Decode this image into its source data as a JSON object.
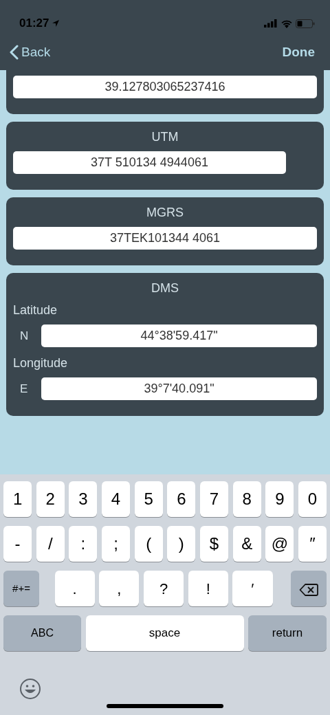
{
  "status_bar": {
    "time": "01:27"
  },
  "nav": {
    "back": "Back",
    "done": "Done"
  },
  "cards": [
    {
      "fields": [
        {
          "value": "39.127803065237416",
          "kind": "wide"
        }
      ]
    },
    {
      "title": "UTM",
      "fields": [
        {
          "value": "37T 510134 4944061",
          "kind": "short"
        }
      ]
    },
    {
      "title": "MGRS",
      "fields": [
        {
          "value": "37TEK101344 4061",
          "kind": "wide"
        }
      ]
    },
    {
      "title": "DMS",
      "fields": [
        {
          "label": "Latitude",
          "prefix": "N",
          "value": "44°38'59.417\"",
          "kind": "wide"
        },
        {
          "label": "Longitude",
          "prefix": "E",
          "value": "39°7'40.091\"",
          "kind": "wide"
        }
      ]
    }
  ],
  "keyboard": {
    "rows": [
      {
        "keys": [
          {
            "label": "1",
            "kind": "char"
          },
          {
            "label": "2",
            "kind": "char"
          },
          {
            "label": "3",
            "kind": "char"
          },
          {
            "label": "4",
            "kind": "char"
          },
          {
            "label": "5",
            "kind": "char"
          },
          {
            "label": "6",
            "kind": "char"
          },
          {
            "label": "7",
            "kind": "char"
          },
          {
            "label": "8",
            "kind": "char"
          },
          {
            "label": "9",
            "kind": "char"
          },
          {
            "label": "0",
            "kind": "char"
          }
        ]
      },
      {
        "keys": [
          {
            "label": "-",
            "kind": "char"
          },
          {
            "label": "/",
            "kind": "char"
          },
          {
            "label": ":",
            "kind": "char"
          },
          {
            "label": ";",
            "kind": "char"
          },
          {
            "label": "(",
            "kind": "char"
          },
          {
            "label": ")",
            "kind": "char"
          },
          {
            "label": "$",
            "kind": "char"
          },
          {
            "label": "&",
            "kind": "char"
          },
          {
            "label": "@",
            "kind": "char"
          },
          {
            "label": "″",
            "kind": "char"
          }
        ]
      },
      {
        "keys": [
          {
            "label": "#+=",
            "kind": "shift"
          },
          {
            "label": ".",
            "kind": "punct"
          },
          {
            "label": ",",
            "kind": "punct"
          },
          {
            "label": "?",
            "kind": "punct"
          },
          {
            "label": "!",
            "kind": "punct"
          },
          {
            "label": "′",
            "kind": "punct"
          },
          {
            "kind": "delete"
          }
        ]
      },
      {
        "keys": [
          {
            "label": "ABC",
            "kind": "mode"
          },
          {
            "label": "space",
            "kind": "space"
          },
          {
            "label": "return",
            "kind": "return"
          }
        ]
      }
    ]
  }
}
